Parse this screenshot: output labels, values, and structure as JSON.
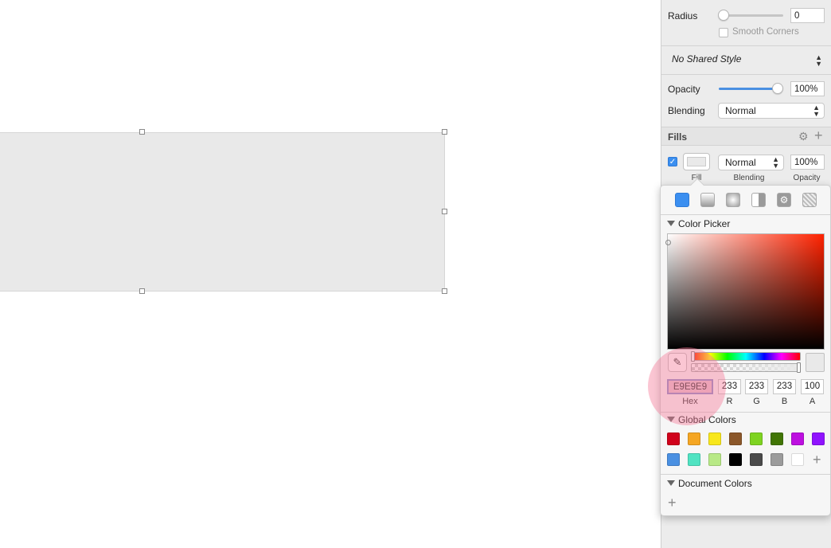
{
  "inspector": {
    "radius": {
      "label": "Radius",
      "value": "0",
      "level": 0,
      "smooth_corners_label": "Smooth Corners",
      "smooth_corners_checked": false
    },
    "shared_style": {
      "value": "No Shared Style"
    },
    "opacity": {
      "label": "Opacity",
      "value": "100%",
      "level": 1.0
    },
    "blending": {
      "label": "Blending",
      "value": "Normal"
    },
    "fills": {
      "title": "Fills",
      "icons": [
        "gear-icon",
        "plus-icon"
      ],
      "row": {
        "enabled": true,
        "color": "#E9E9E9",
        "blend": "Normal",
        "opacity": "100%"
      },
      "sub_labels": {
        "fill": "Fill",
        "blending": "Blending",
        "opacity": "Opacity"
      }
    }
  },
  "color_popover": {
    "fill_types": [
      "solid-fill-icon",
      "linear-gradient-icon",
      "radial-gradient-icon",
      "angular-gradient-icon",
      "pattern-fill-icon",
      "noise-fill-icon"
    ],
    "picker_title": "Color Picker",
    "hex": "E9E9E9",
    "r": "233",
    "g": "233",
    "b": "233",
    "a": "100",
    "labels": {
      "hex": "Hex",
      "r": "R",
      "g": "G",
      "b": "B",
      "a": "A"
    },
    "global_colors_title": "Global Colors",
    "global_colors": [
      "#D0021B",
      "#F5A623",
      "#F8E71C",
      "#8B572A",
      "#7ED321",
      "#417505",
      "#BD10E0",
      "#9013FE",
      "#4A90E2",
      "#50E3C2",
      "#B8E986",
      "#000000",
      "#4A4A4A",
      "#9B9B9B",
      "#FFFFFF"
    ],
    "document_colors_title": "Document Colors"
  },
  "canvas": {
    "shape_fill": "#E9E9E9"
  }
}
